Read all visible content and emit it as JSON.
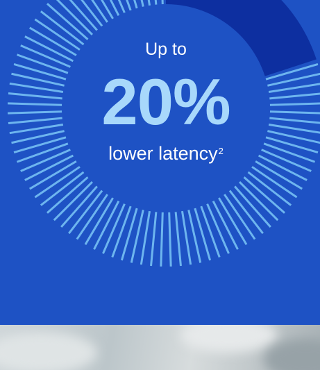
{
  "stat": {
    "prefix": "Up to",
    "value": "20%",
    "suffix": "lower latency",
    "footnote": "2",
    "fraction": 0.2
  },
  "colors": {
    "background": "#1e52c4",
    "tick": "#6db5ef",
    "arc_fill": "#0d2fa0",
    "value_text": "#a8d8fb",
    "text": "#ffffff"
  }
}
